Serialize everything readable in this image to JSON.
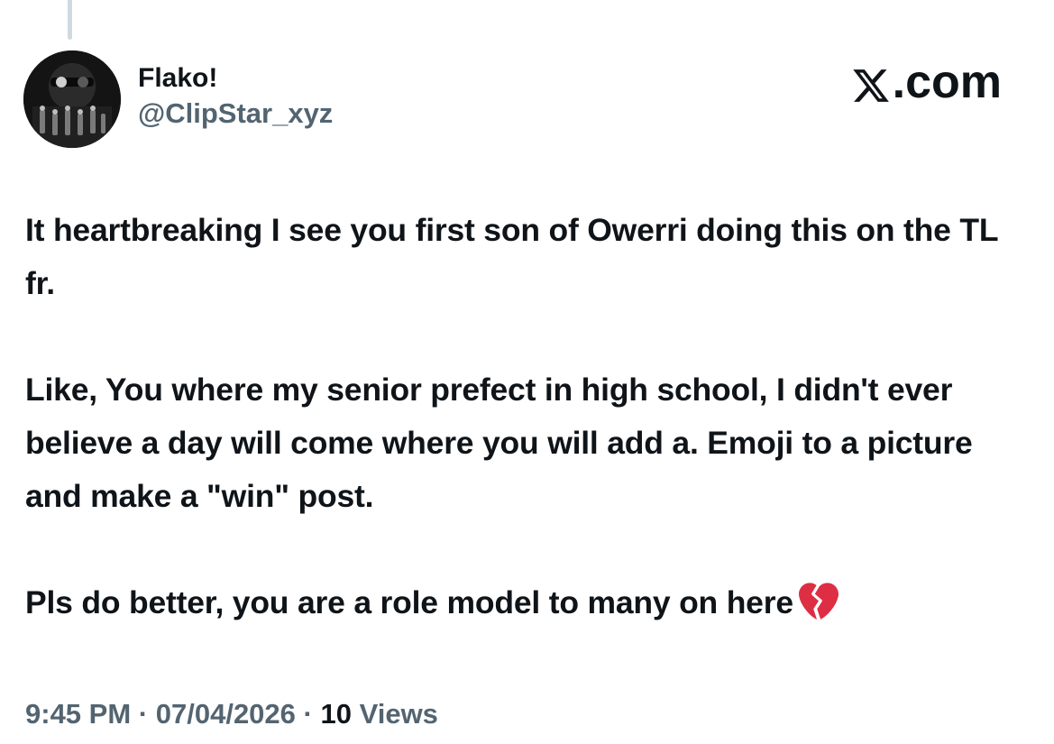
{
  "post": {
    "author": {
      "display_name": "Flako!",
      "handle": "@ClipStar_xyz"
    },
    "brand": {
      "icon": "x-logo-icon",
      "text": ".com"
    },
    "paragraphs": [
      "It heartbreaking I see you first son of Owerri doing this on the TL fr.",
      "Like, You where my senior prefect in high school, I didn't ever believe a day will come where you will add a. Emoji to a picture and make a \"win\" post.",
      "Pls do better, you are a role model to many on here"
    ],
    "trailing_emoji": "broken-heart-icon",
    "meta": {
      "time": "9:45 PM",
      "separator": "·",
      "date": "07/04/2026",
      "views_count": "10",
      "views_label": "Views"
    }
  },
  "colors": {
    "text_primary": "#0f1419",
    "text_secondary": "#536471",
    "thread_line": "#cfd9de",
    "emoji_red": "#e0245e"
  }
}
